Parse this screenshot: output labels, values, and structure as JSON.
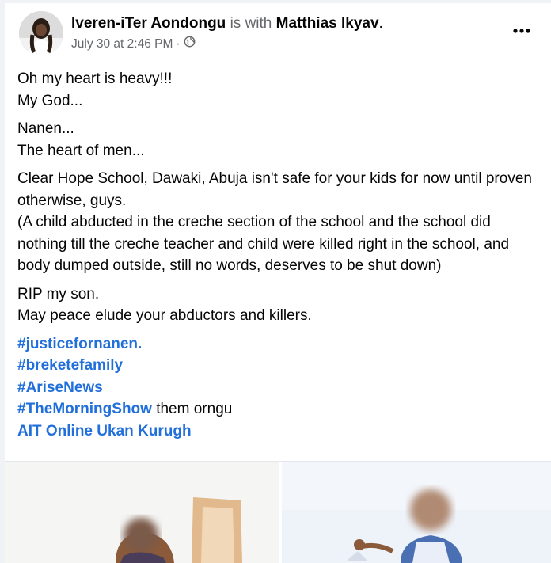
{
  "post": {
    "author_name": "Iveren-iTer Aondongu",
    "with_text": "is with",
    "tagged_name": "Matthias Ikyav",
    "period": ".",
    "timestamp": "July 30 at 2:46 PM",
    "separator": "·",
    "privacy_icon": "globe-icon",
    "more_icon": "more-options-icon",
    "paragraphs": [
      [
        "Oh my heart is heavy!!!",
        "My God..."
      ],
      [
        "Nanen...",
        "The heart of men..."
      ],
      [
        "Clear Hope School, Dawaki, Abuja isn't safe for your kids for now until proven otherwise, guys.",
        "(A child abducted in the creche section of the school and the school did nothing till the creche teacher and child were killed right in the school, and body dumped outside,  still no words, deserves to be shut down)"
      ],
      [
        "RIP my son.",
        "May peace elude your abductors and killers."
      ]
    ],
    "hashtags": {
      "h1": "#justicefornanen.",
      "h2": "#breketefamily",
      "h3": "#AriseNews",
      "h4": "#TheMorningShow",
      "h4_after": " them orngu",
      "h5": "AIT Online Ukan Kurugh"
    }
  },
  "colors": {
    "link": "#216fdb",
    "muted": "#65676b",
    "text": "#050505"
  }
}
